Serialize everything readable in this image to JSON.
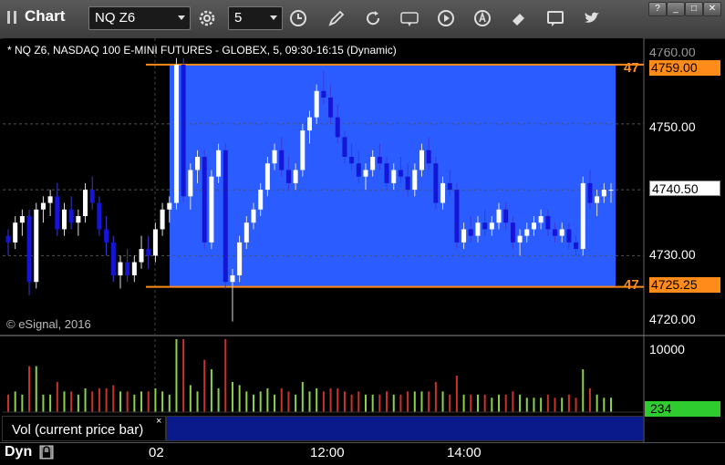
{
  "app": {
    "title": "Chart"
  },
  "toolbar": {
    "symbol": "NQ Z6",
    "interval": "5",
    "icons": [
      "settings-icon",
      "clock-icon",
      "pencil-icon",
      "refresh-icon",
      "get-icon",
      "play-icon",
      "alert-icon",
      "eraser-icon",
      "comment-icon",
      "twitter-icon"
    ]
  },
  "window_controls": {
    "help": "?",
    "minimize": "_",
    "maximize": "□",
    "close": "✕"
  },
  "chart": {
    "header": "* NQ Z6, NASDAQ 100 E-MINI FUTURES - GLOBEX, 5, 09:30-16:15 (Dynamic)",
    "watermark": "© eSignal, 2016",
    "left_tags": {
      "upper": "47",
      "lower": "47"
    },
    "top_partial_label": "4760.00",
    "colors": {
      "up": "#ffffff",
      "down": "#1515d8",
      "zone": "#2b5cff",
      "line": "#ff8c1a",
      "vol_up": "#8bd24a",
      "vol_down": "#c8322a"
    }
  },
  "price_axis": {
    "ticks": [
      "4750.00",
      "4730.00",
      "4720.00"
    ],
    "upper_line_label": "4759.00",
    "current_price": "4740.50",
    "lower_line_label": "4725.25"
  },
  "volume": {
    "label": "Vol (current price bar)",
    "close_symbol": "×",
    "axis_tick": "10000",
    "current_value": "234"
  },
  "bottom": {
    "mode": "Dyn",
    "time_ticks": [
      "02",
      "12:00",
      "14:00"
    ]
  },
  "chart_data": {
    "type": "candlestick",
    "price_lines": [
      4759.0,
      4725.25
    ],
    "current_price": 4740.5,
    "price_range": [
      4718,
      4763
    ],
    "candles": [
      [
        4733,
        4734,
        4730,
        4732
      ],
      [
        4732,
        4736,
        4731,
        4735
      ],
      [
        4735,
        4737,
        4733,
        4736
      ],
      [
        4736,
        4737,
        4724,
        4726
      ],
      [
        4726,
        4738,
        4725,
        4737
      ],
      [
        4737,
        4739,
        4735,
        4738
      ],
      [
        4738,
        4740,
        4736,
        4739
      ],
      [
        4739,
        4741,
        4733,
        4734
      ],
      [
        4734,
        4738,
        4733,
        4737
      ],
      [
        4737,
        4739,
        4734,
        4735
      ],
      [
        4735,
        4737,
        4733,
        4736
      ],
      [
        4736,
        4741,
        4735,
        4740
      ],
      [
        4740,
        4742,
        4737,
        4738
      ],
      [
        4738,
        4739,
        4733,
        4734
      ],
      [
        4734,
        4736,
        4730,
        4732
      ],
      [
        4732,
        4733,
        4726,
        4727
      ],
      [
        4727,
        4730,
        4725,
        4729
      ],
      [
        4729,
        4731,
        4726,
        4727
      ],
      [
        4727,
        4730,
        4726,
        4729
      ],
      [
        4729,
        4733,
        4728,
        4731
      ],
      [
        4731,
        4733,
        4728,
        4730
      ],
      [
        4730,
        4735,
        4729,
        4734
      ],
      [
        4734,
        4738,
        4733,
        4737
      ],
      [
        4737,
        4739,
        4735,
        4738
      ],
      [
        4738,
        4760,
        4737,
        4759
      ],
      [
        4759,
        4760,
        4738,
        4739
      ],
      [
        4739,
        4744,
        4737,
        4743
      ],
      [
        4743,
        4746,
        4741,
        4745
      ],
      [
        4745,
        4746,
        4731,
        4732
      ],
      [
        4732,
        4743,
        4731,
        4742
      ],
      [
        4742,
        4747,
        4741,
        4746
      ],
      [
        4746,
        4747,
        4725,
        4726
      ],
      [
        4726,
        4728,
        4720,
        4727
      ],
      [
        4727,
        4733,
        4726,
        4732
      ],
      [
        4732,
        4736,
        4731,
        4735
      ],
      [
        4735,
        4738,
        4734,
        4737
      ],
      [
        4737,
        4741,
        4736,
        4740
      ],
      [
        4740,
        4745,
        4739,
        4744
      ],
      [
        4744,
        4747,
        4743,
        4746
      ],
      [
        4746,
        4748,
        4742,
        4743
      ],
      [
        4743,
        4745,
        4740,
        4741
      ],
      [
        4741,
        4744,
        4740,
        4743
      ],
      [
        4743,
        4750,
        4742,
        4749
      ],
      [
        4749,
        4752,
        4747,
        4751
      ],
      [
        4751,
        4756,
        4750,
        4755
      ],
      [
        4755,
        4758,
        4753,
        4754
      ],
      [
        4754,
        4756,
        4750,
        4751
      ],
      [
        4751,
        4753,
        4747,
        4748
      ],
      [
        4748,
        4749,
        4744,
        4745
      ],
      [
        4745,
        4747,
        4743,
        4744
      ],
      [
        4744,
        4746,
        4741,
        4742
      ],
      [
        4742,
        4744,
        4740,
        4743
      ],
      [
        4743,
        4746,
        4742,
        4745
      ],
      [
        4745,
        4747,
        4743,
        4744
      ],
      [
        4744,
        4745,
        4740,
        4741
      ],
      [
        4741,
        4744,
        4740,
        4743
      ],
      [
        4743,
        4745,
        4741,
        4742
      ],
      [
        4742,
        4744,
        4739,
        4740
      ],
      [
        4740,
        4744,
        4739,
        4743
      ],
      [
        4743,
        4747,
        4742,
        4746
      ],
      [
        4746,
        4748,
        4743,
        4744
      ],
      [
        4744,
        4745,
        4737,
        4738
      ],
      [
        4738,
        4742,
        4737,
        4741
      ],
      [
        4741,
        4743,
        4739,
        4740
      ],
      [
        4740,
        4741,
        4731,
        4732
      ],
      [
        4732,
        4735,
        4731,
        4734
      ],
      [
        4734,
        4736,
        4732,
        4733
      ],
      [
        4733,
        4736,
        4732,
        4735
      ],
      [
        4735,
        4737,
        4733,
        4734
      ],
      [
        4734,
        4736,
        4733,
        4735
      ],
      [
        4735,
        4738,
        4734,
        4737
      ],
      [
        4737,
        4738,
        4734,
        4735
      ],
      [
        4735,
        4736,
        4731,
        4732
      ],
      [
        4732,
        4734,
        4730,
        4733
      ],
      [
        4733,
        4735,
        4732,
        4734
      ],
      [
        4734,
        4736,
        4733,
        4735
      ],
      [
        4735,
        4737,
        4734,
        4736
      ],
      [
        4736,
        4737,
        4733,
        4734
      ],
      [
        4734,
        4735,
        4732,
        4733
      ],
      [
        4733,
        4735,
        4732,
        4734
      ],
      [
        4734,
        4735,
        4731,
        4732
      ],
      [
        4732,
        4733,
        4730,
        4731
      ],
      [
        4731,
        4742,
        4730,
        4741
      ],
      [
        4741,
        4743,
        4737,
        4738
      ],
      [
        4738,
        4740,
        4736,
        4739
      ],
      [
        4739,
        4741,
        4738,
        4740
      ],
      [
        4740,
        4741,
        4738,
        4740
      ]
    ],
    "volume_range": [
      0,
      12000
    ]
  }
}
